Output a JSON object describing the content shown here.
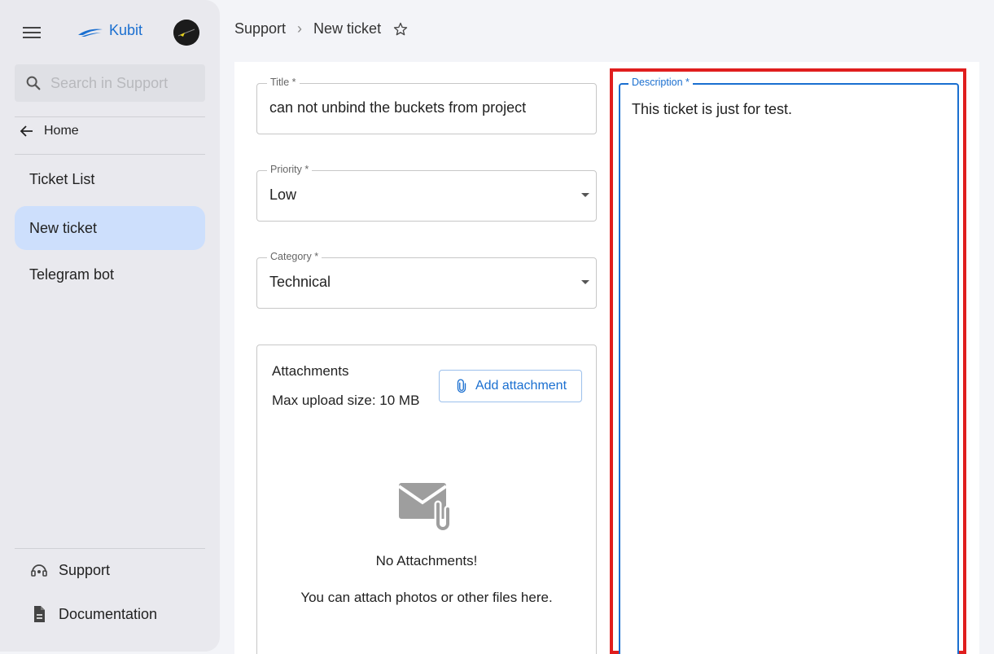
{
  "app": {
    "name": "Kubit"
  },
  "sidebar": {
    "search_placeholder": "Search in Support",
    "home_label": "Home",
    "items": [
      {
        "label": "Ticket List",
        "active": false
      },
      {
        "label": "New ticket",
        "active": true
      },
      {
        "label": "Telegram bot",
        "active": false
      }
    ],
    "bottom": [
      {
        "label": "Support",
        "icon": "support-agent-icon"
      },
      {
        "label": "Documentation",
        "icon": "document-icon"
      }
    ]
  },
  "header": {
    "breadcrumb": [
      "Support",
      "New ticket"
    ]
  },
  "form": {
    "title": {
      "label": "Title *",
      "value": "can not unbind the buckets from project"
    },
    "priority": {
      "label": "Priority *",
      "value": "Low"
    },
    "category": {
      "label": "Category *",
      "value": "Technical"
    },
    "description": {
      "label": "Description *",
      "value": "This ticket is just for test."
    },
    "attachments": {
      "heading": "Attachments",
      "max_size": "Max upload size: 10 MB",
      "add_button": "Add attachment",
      "empty_title": "No Attachments!",
      "empty_subtitle": "You can attach photos or other files here."
    }
  },
  "colors": {
    "accent": "#1a6fd0",
    "active_nav": "#cddffc",
    "highlight": "#e01e1e"
  }
}
